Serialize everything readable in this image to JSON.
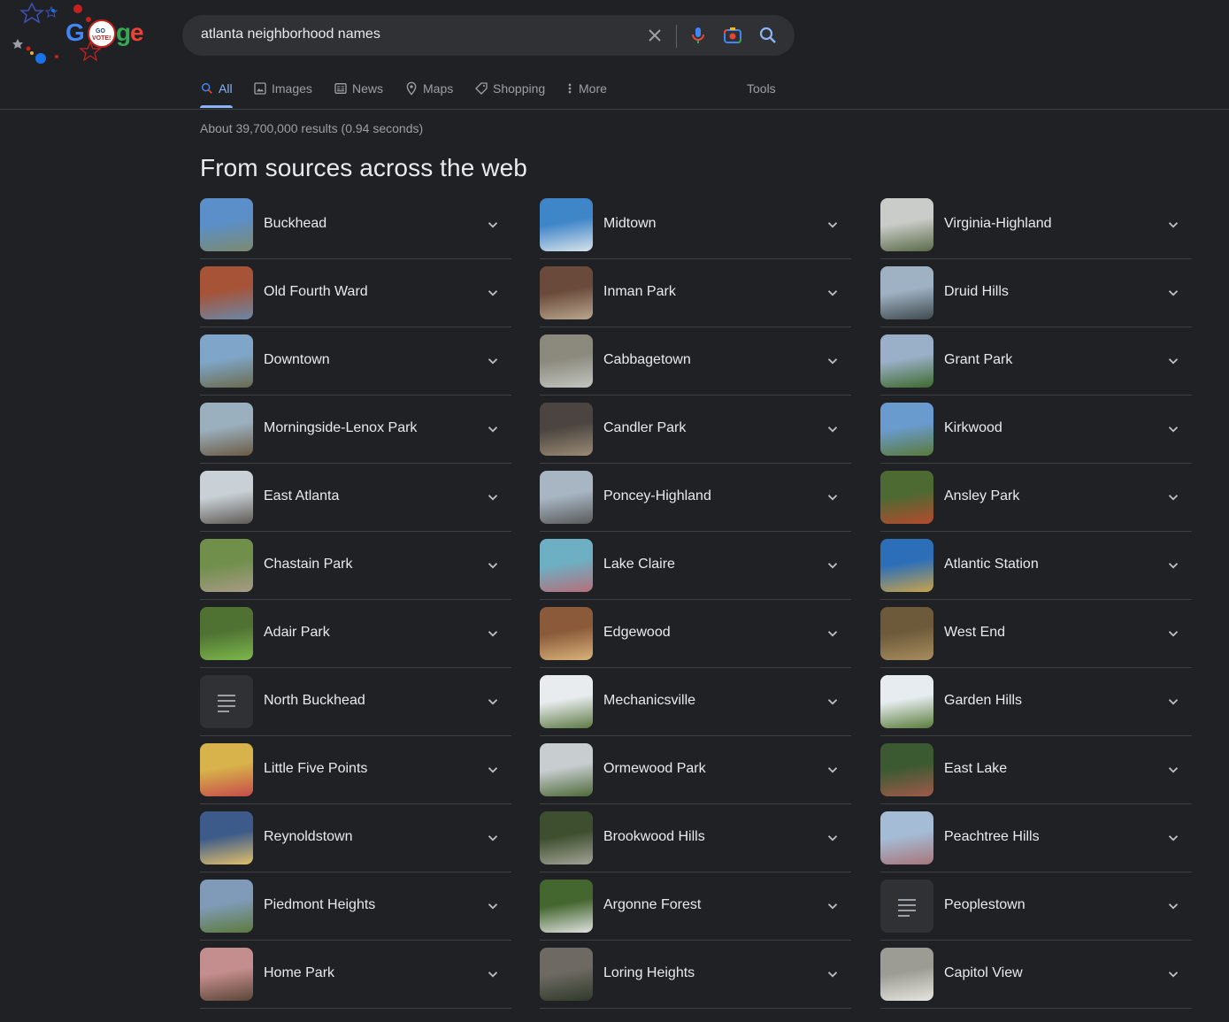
{
  "search": {
    "query": "atlanta neighborhood names"
  },
  "tabs": [
    {
      "label": "All",
      "icon": "search-icon",
      "active": true
    },
    {
      "label": "Images",
      "icon": "image-icon"
    },
    {
      "label": "News",
      "icon": "news-icon"
    },
    {
      "label": "Maps",
      "icon": "map-pin-icon"
    },
    {
      "label": "Shopping",
      "icon": "tag-icon"
    },
    {
      "label": "More",
      "icon": "more-vert-icon"
    }
  ],
  "tools_label": "Tools",
  "result_stats": "About 39,700,000 results (0.94 seconds)",
  "section_title": "From sources across the web",
  "logo": {
    "badge_text_1": "GO",
    "badge_text_2": "VOTE!"
  },
  "neighborhoods": {
    "col1": [
      {
        "name": "Buckhead",
        "thumb": [
          "#5b8fc9",
          "#7c8a6e"
        ]
      },
      {
        "name": "Old Fourth Ward",
        "thumb": [
          "#a65338",
          "#6b87a8"
        ]
      },
      {
        "name": "Downtown",
        "thumb": [
          "#7fa6c9",
          "#6b6b4e"
        ]
      },
      {
        "name": "Morningside-Lenox Park",
        "thumb": [
          "#9bb0bf",
          "#6b5a42"
        ]
      },
      {
        "name": "East Atlanta",
        "thumb": [
          "#c9d1d6",
          "#5e5a55"
        ]
      },
      {
        "name": "Chastain Park",
        "thumb": [
          "#6f8f4a",
          "#a89a86"
        ]
      },
      {
        "name": "Adair Park",
        "thumb": [
          "#4f7233",
          "#7cb74b"
        ]
      },
      {
        "name": "North Buckhead",
        "thumb": null
      },
      {
        "name": "Little Five Points",
        "thumb": [
          "#d8b24a",
          "#c64b4b"
        ]
      },
      {
        "name": "Reynoldstown",
        "thumb": [
          "#3c5b8a",
          "#e2c06b"
        ]
      },
      {
        "name": "Piedmont Heights",
        "thumb": [
          "#7f9bb8",
          "#5d7a3c"
        ]
      },
      {
        "name": "Home Park",
        "thumb": [
          "#c58e8e",
          "#5b4636"
        ]
      }
    ],
    "col2": [
      {
        "name": "Midtown",
        "thumb": [
          "#3f86c9",
          "#d7e2ea"
        ]
      },
      {
        "name": "Inman Park",
        "thumb": [
          "#6a4a3a",
          "#b9a68e"
        ]
      },
      {
        "name": "Cabbagetown",
        "thumb": [
          "#8c8a7d",
          "#c2c5c0"
        ]
      },
      {
        "name": "Candler Park",
        "thumb": [
          "#4b4440",
          "#9a8b74"
        ]
      },
      {
        "name": "Poncey-Highland",
        "thumb": [
          "#a8b6c4",
          "#5a5a5a"
        ]
      },
      {
        "name": "Lake Claire",
        "thumb": [
          "#6db0c4",
          "#b56f7a"
        ]
      },
      {
        "name": "Edgewood",
        "thumb": [
          "#8a5a3a",
          "#d9b27a"
        ]
      },
      {
        "name": "Mechanicsville",
        "thumb": [
          "#e9ecef",
          "#5d7a43"
        ]
      },
      {
        "name": "Ormewood Park",
        "thumb": [
          "#c8cdd0",
          "#4d6a38"
        ]
      },
      {
        "name": "Brookwood Hills",
        "thumb": [
          "#3e4f2f",
          "#a3a396"
        ]
      },
      {
        "name": "Argonne Forest",
        "thumb": [
          "#44662f",
          "#e0e2df"
        ]
      },
      {
        "name": "Loring Heights",
        "thumb": [
          "#6e6a63",
          "#2f3a2a"
        ]
      }
    ],
    "col3": [
      {
        "name": "Virginia-Highland",
        "thumb": [
          "#c9ccc8",
          "#5b6a4a"
        ]
      },
      {
        "name": "Druid Hills",
        "thumb": [
          "#9fb2c4",
          "#3f4a4e"
        ]
      },
      {
        "name": "Grant Park",
        "thumb": [
          "#9ab0c8",
          "#3e6a2e"
        ]
      },
      {
        "name": "Kirkwood",
        "thumb": [
          "#6a9bcf",
          "#5a7a3a"
        ]
      },
      {
        "name": "Ansley Park",
        "thumb": [
          "#4d6a33",
          "#b64a2e"
        ]
      },
      {
        "name": "Atlantic Station",
        "thumb": [
          "#2c6fb8",
          "#c9a24a"
        ]
      },
      {
        "name": "West End",
        "thumb": [
          "#6c5a3a",
          "#a88d5e"
        ]
      },
      {
        "name": "Garden Hills",
        "thumb": [
          "#e6ecef",
          "#5a7c3a"
        ]
      },
      {
        "name": "East Lake",
        "thumb": [
          "#3c5a32",
          "#a05a4a"
        ]
      },
      {
        "name": "Peachtree Hills",
        "thumb": [
          "#a4bcd6",
          "#a8767a"
        ]
      },
      {
        "name": "Peoplestown",
        "thumb": null
      },
      {
        "name": "Capitol View",
        "thumb": [
          "#9c9c94",
          "#e6e6e0"
        ]
      }
    ]
  },
  "colors": {
    "background": "#202124",
    "searchbox": "#303134",
    "accent": "#8ab4f8",
    "text": "#e8eaed",
    "muted": "#9aa0a6",
    "divider": "#3c4043"
  }
}
